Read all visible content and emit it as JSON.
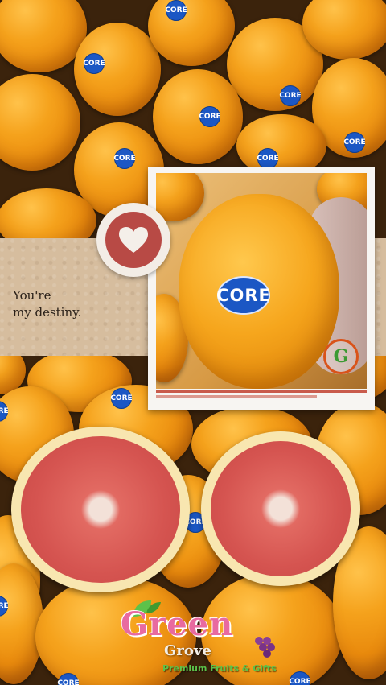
{
  "tagline": {
    "line1": "You're",
    "line2": "my destiny."
  },
  "sticker_text": "CORE",
  "brand": {
    "name_first": "Green",
    "name_second": "Grove",
    "tagline": "Premium Fruits & Gifts",
    "monogram": "G"
  },
  "colors": {
    "orange": "#f5a21c",
    "sticker_blue": "#1b57c4",
    "paper": "#d6bd9e",
    "heart_circle": "#b84a45",
    "grapefruit_flesh": "#d55450",
    "brand_pink": "#e86aa0",
    "brand_green": "#5cc24a"
  },
  "icons": {
    "heart": "heart-icon",
    "logo": "green-grove-logo"
  }
}
